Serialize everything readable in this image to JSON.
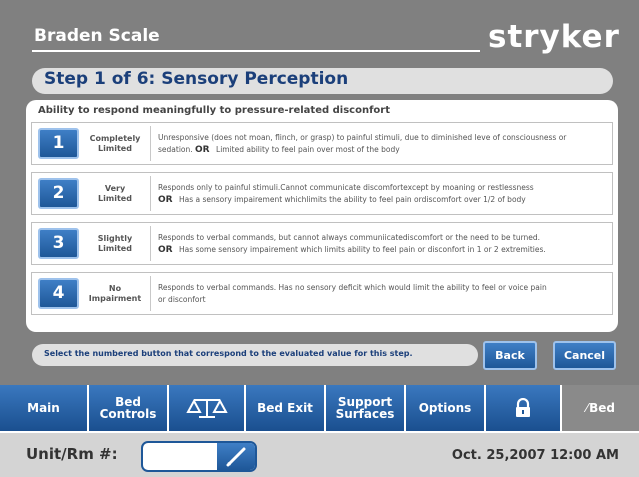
{
  "header": {
    "title": "Braden Scale",
    "brand": "stryker"
  },
  "step": {
    "title": "Step 1 of 6: Sensory Perception"
  },
  "panel": {
    "subtitle": "Ability to respond meaningfully to pressure-related disconfort"
  },
  "options": [
    {
      "number": "1",
      "label_line1": "Completely",
      "label_line2": "Limited",
      "desc_line1": "Unresponsive (does not moan, flinch, or grasp) to painful stimuli, due to diminished leve of consciousness or",
      "desc_line2_prefix": "sedation.",
      "or": "OR",
      "desc_line2": "Limited ability to feel pain over most of the body"
    },
    {
      "number": "2",
      "label_line1": "Very",
      "label_line2": "Limited",
      "desc_line1": "Responds only to painful stimuli.Cannot communicate discomfortexcept by moaning or restlessness",
      "desc_line2_prefix": "",
      "or": "OR",
      "desc_line2": "Has a sensory impairement whichlimits the ability to feel pain ordiscomfort over 1/2  of body"
    },
    {
      "number": "3",
      "label_line1": "Slightly",
      "label_line2": "Limited",
      "desc_line1": "Responds to verbal commands, but cannot always communiicatediscomfort or the need to be turned.",
      "desc_line2_prefix": "",
      "or": "OR",
      "desc_line2": "Has some sensory impairement which limits ability to feel pain or disconfort in 1 or 2 extremities."
    },
    {
      "number": "4",
      "label_line1": "No",
      "label_line2": "Impairment",
      "desc_line1": "Responds to verbal commands. Has no sensory deficit which would limit the ability to feel or voice pain",
      "desc_line2_prefix": "",
      "or": "",
      "desc_line2": "or disconfort"
    }
  ],
  "instruction": "Select the numbered button that correspond to the evaluated value for this step.",
  "actions": {
    "back": "Back",
    "cancel": "Cancel"
  },
  "nav": {
    "main": "Main",
    "bed_controls_1": "Bed",
    "bed_controls_2": "Controls",
    "scale_icon": "scale-icon",
    "bed_exit": "Bed Exit",
    "support_1": "Support",
    "support_2": "Surfaces",
    "options": "Options",
    "lock_icon": "lock-icon",
    "bed_pen": "⁄",
    "bed": "Bed"
  },
  "status": {
    "unit_label": "Unit/Rm #:",
    "unit_value": "",
    "datetime": "Oct. 25,2007  12:00 AM"
  },
  "colors": {
    "accent": "#1e5798",
    "title_text": "#1b3f7a",
    "background": "#808080"
  }
}
